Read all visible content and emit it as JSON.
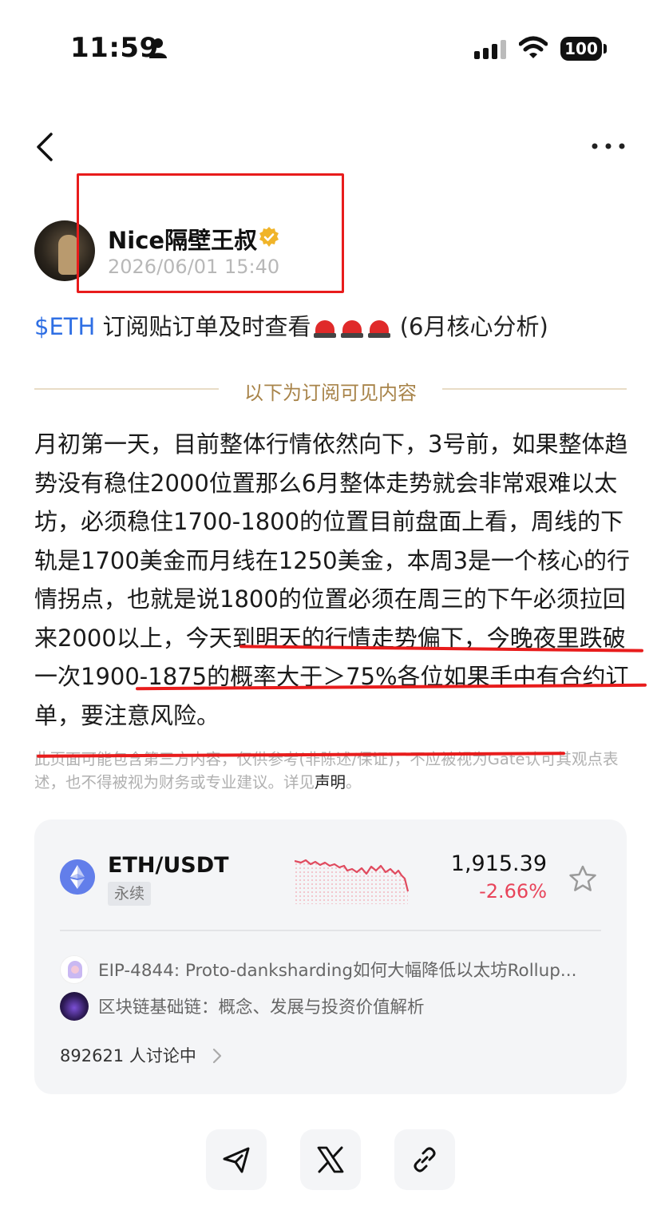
{
  "status_bar": {
    "time": "11:59",
    "battery": "100"
  },
  "author": {
    "name": "Nice隔壁王叔",
    "time": "2026/06/01 15:40"
  },
  "post": {
    "ticker": "$ETH",
    "title_text": " 订阅贴订单及时查看",
    "title_suffix": " (6月核心分析)",
    "subscription_label": "以下为订阅可见内容",
    "body": "月初第一天，目前整体行情依然向下，3号前，如果整体趋势没有稳住2000位置那么6月整体走势就会非常艰难以太坊，必须稳住1700-1800的位置目前盘面上看，周线的下轨是1700美金而月线在1250美金，本周3是一个核心的行情拐点，也就是说1800的位置必须在周三的下午必须拉回来2000以上，今天到明天的行情走势偏下，今晚夜里跌破一次1900-1875的概率大于＞75%各位如果手中有合约订单，要注意风险。",
    "disclaimer": "此页面可能包含第三方内容，仅供参考(非陈述/保证)，不应被视为Gate认可其观点表述，也不得被视为财务或专业建议。详见",
    "disclaimer_link": "声明",
    "disclaimer_end": "。"
  },
  "card": {
    "pair": "ETH/USDT",
    "badge": "永续",
    "price": "1,915.39",
    "change": "-2.66%",
    "related": [
      {
        "title": "EIP-4844: Proto-danksharding如何大幅降低以太坊Rollup..."
      },
      {
        "title": "区块链基础链：概念、发展与投资价值解析"
      }
    ],
    "discussion_count": "892621 人讨论中"
  },
  "colors": {
    "ticker": "#2f6fe4",
    "negative": "#e8445a",
    "annotation_red": "#e81c1c",
    "gold": "#a8844a"
  },
  "icons": [
    "person-icon",
    "signal-icon",
    "wifi-icon",
    "back-icon",
    "more-icon",
    "verified-icon",
    "siren-icon",
    "eth-icon",
    "star-icon",
    "chevron-right-icon",
    "send-icon",
    "x-logo-icon",
    "link-icon"
  ]
}
